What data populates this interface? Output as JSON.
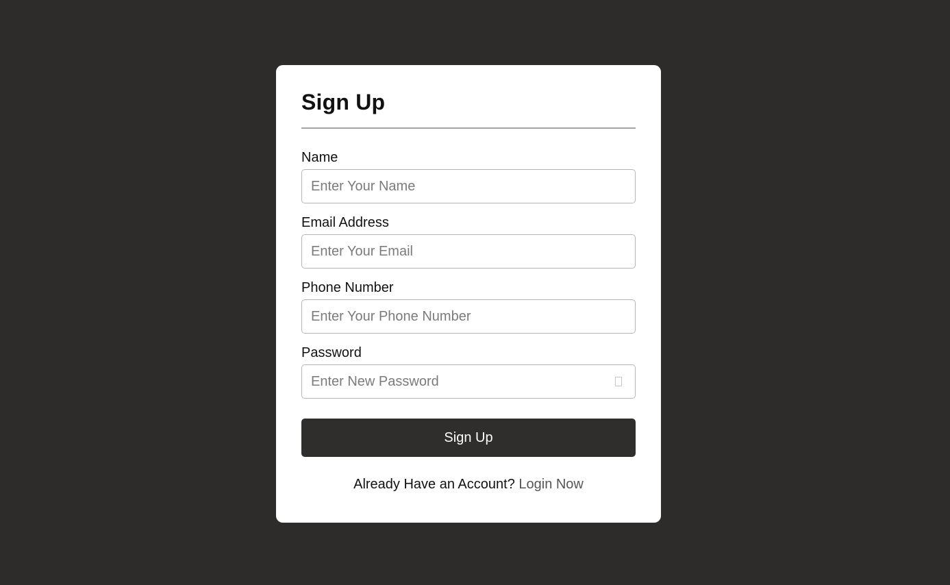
{
  "form": {
    "title": "Sign Up",
    "fields": [
      {
        "label": "Name",
        "placeholder": "Enter Your Name",
        "type": "text"
      },
      {
        "label": "Email Address",
        "placeholder": "Enter Your Email",
        "type": "email"
      },
      {
        "label": "Phone Number",
        "placeholder": "Enter Your Phone Number",
        "type": "tel"
      },
      {
        "label": "Password",
        "placeholder": "Enter New Password",
        "type": "password"
      }
    ],
    "submit_label": "Sign Up",
    "footer": {
      "prompt": "Already Have an Account?",
      "link_label": "Login Now"
    }
  },
  "colors": {
    "page_background": "#2d2c2b",
    "card_background": "#ffffff",
    "button_background": "#2f2e2d",
    "link": "#555555"
  },
  "icons": {
    "password_toggle": "eye-icon"
  }
}
